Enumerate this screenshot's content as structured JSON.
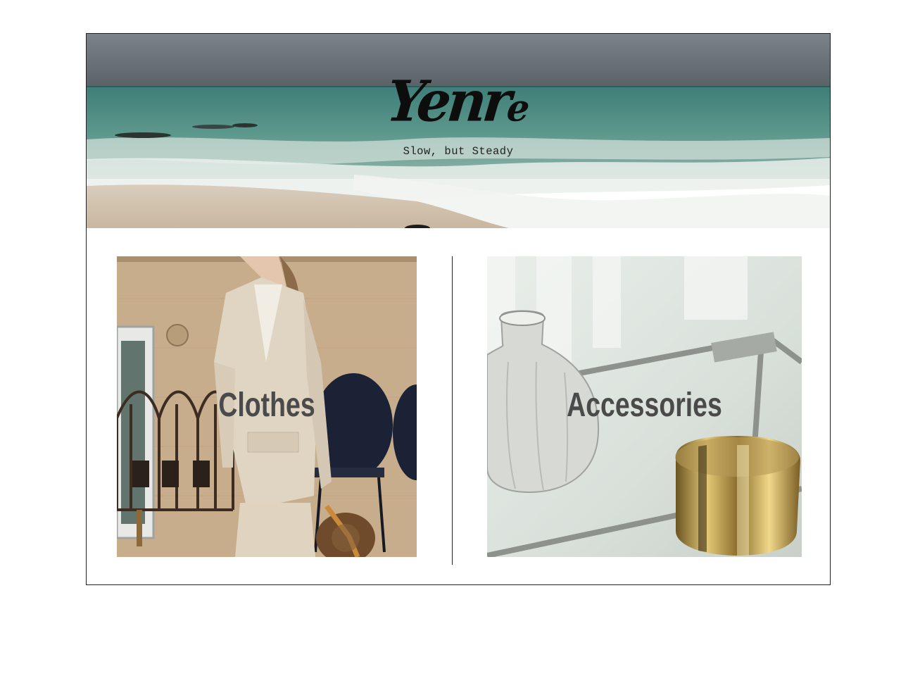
{
  "brand": {
    "logo_main": "Yenr",
    "logo_tail": "e",
    "tagline": "Slow, but Steady"
  },
  "categories": [
    {
      "label": "Clothes"
    },
    {
      "label": "Accessories"
    }
  ],
  "colors": {
    "frame_border": "#222222",
    "label_text": "#4a4a4a",
    "logo_text": "#0d0d0d"
  }
}
